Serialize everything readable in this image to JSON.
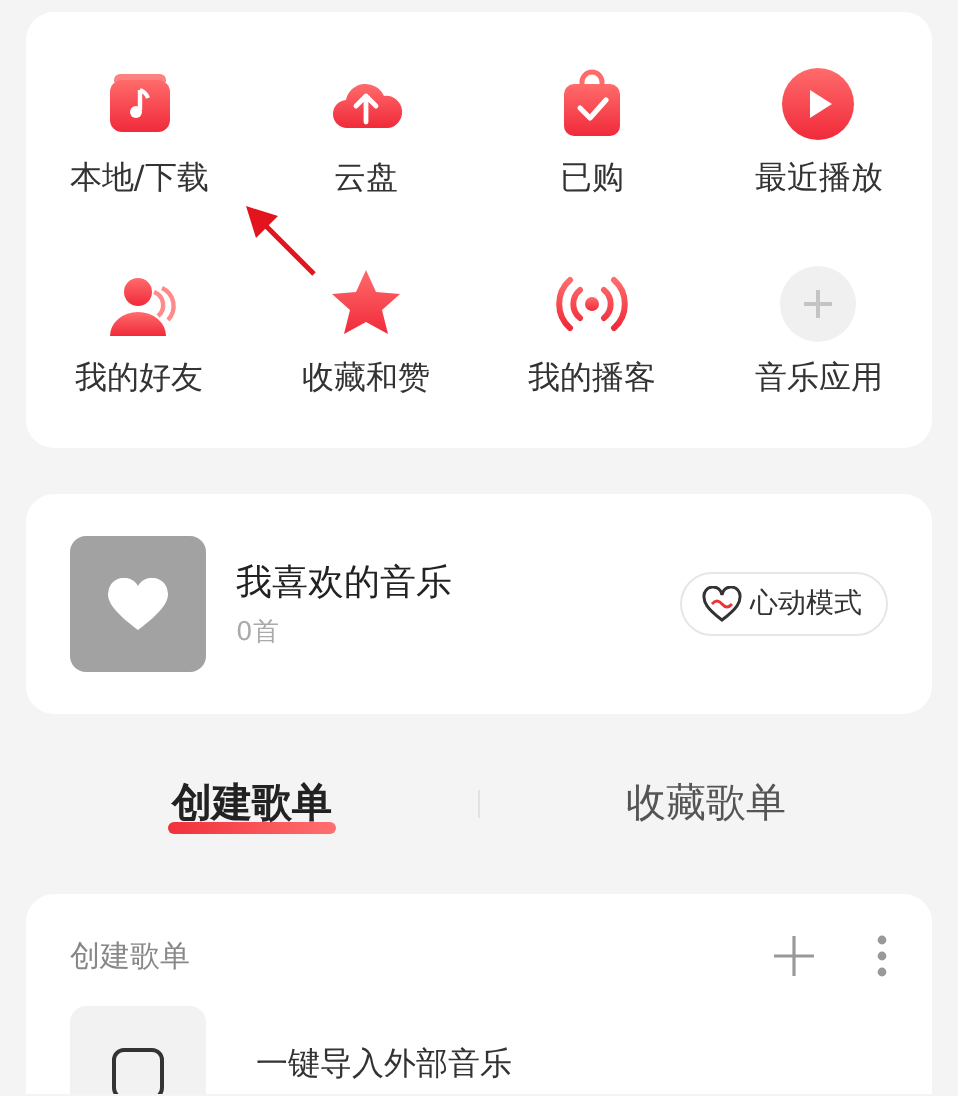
{
  "shortcuts": [
    {
      "label": "本地/下载",
      "kind": "music"
    },
    {
      "label": "云盘",
      "kind": "cloud"
    },
    {
      "label": "已购",
      "kind": "bag"
    },
    {
      "label": "最近播放",
      "kind": "play"
    },
    {
      "label": "我的好友",
      "kind": "friends"
    },
    {
      "label": "收藏和赞",
      "kind": "star"
    },
    {
      "label": "我的播客",
      "kind": "broadcast"
    },
    {
      "label": "音乐应用",
      "kind": "add"
    }
  ],
  "annotation": {
    "kind": "arrow"
  },
  "liked": {
    "title": "我喜欢的音乐",
    "count": "0首",
    "mode_button": "心动模式"
  },
  "tabs": [
    {
      "label": "创建歌单",
      "selected": true
    },
    {
      "label": "收藏歌单",
      "selected": false
    }
  ],
  "playlists": {
    "header": "创建歌单",
    "rows": [
      {
        "title": "一键导入外部音乐"
      }
    ]
  }
}
